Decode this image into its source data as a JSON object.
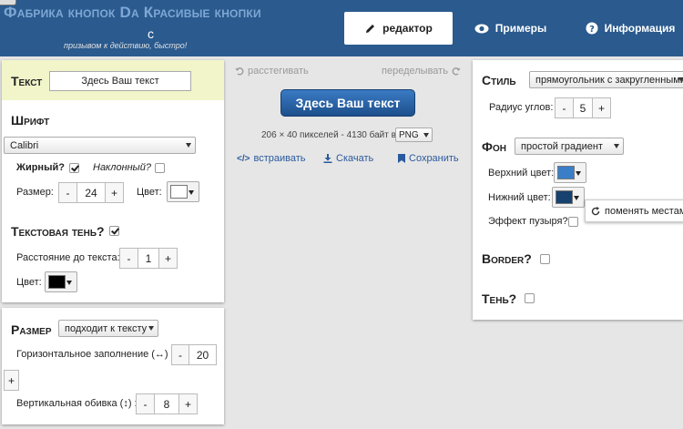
{
  "header": {
    "logo_title": "Фабрика кнопок Da Красивые кнопки",
    "logo_c": "с",
    "logo_subtitle": "призывом к действию, быстро!",
    "nav": [
      {
        "label": "редактор",
        "icon": "pencil-icon"
      },
      {
        "label": "Примеры",
        "icon": "eye-icon"
      },
      {
        "label": "Информация",
        "icon": "question-circle-icon"
      }
    ]
  },
  "left_text_panel": {
    "text_title": "Текст",
    "text_value": "Здесь Ваш текст",
    "font_title": "Шрифт",
    "font_value": "Calibri",
    "bold_label": "Жирный?",
    "bold_checked": true,
    "italic_label": "Наклонный?",
    "italic_checked": false,
    "size_label": "Размер:",
    "size_value": "24",
    "color_label": "Цвет:",
    "color_value": "#ffffff",
    "shadow_title": "Текстовая тень?",
    "shadow_checked": true,
    "distance_label": "Расстояние до текста:",
    "distance_value": "1",
    "shadow_color_label": "Цвет:",
    "shadow_color_value": "#000000"
  },
  "left_size_panel": {
    "size_title": "Размер",
    "size_mode": "подходит к тексту",
    "horizontal_label": "Горизонтальное заполнение (↔) :",
    "horizontal_value": "20",
    "vertical_label": "Вертикальная обивка (↕) :",
    "vertical_value": "8"
  },
  "center": {
    "undo_label": "расстегивать",
    "redo_label": "переделывать",
    "button_text": "Здесь Ваш текст",
    "info_text": "206 × 40  пикселей - 4130  байт в",
    "format_value": "PNG",
    "embed_label": "встраивать",
    "download_label": "Скачать",
    "save_label": "Сохранить"
  },
  "right_panel": {
    "style_title": "Стиль",
    "style_value": "прямоугольник с закругленными углами",
    "radius_label": "Радиус углов:",
    "radius_value": "5",
    "bg_title": "Фон",
    "bg_value": "простой градиент",
    "top_color_label": "Верхний цвет:",
    "top_color_value": "#3a7ec8",
    "bottom_color_label": "Нижний цвет:",
    "bottom_color_value": "#17416f",
    "swap_label": "поменять местами",
    "bubble_label": "Эффект пузыря?",
    "bubble_checked": false,
    "border_title": "Border?",
    "border_checked": false,
    "shadow_title": "Тень?",
    "shadow_checked": false
  },
  "steppers": {
    "minus": "-",
    "plus": "+"
  }
}
